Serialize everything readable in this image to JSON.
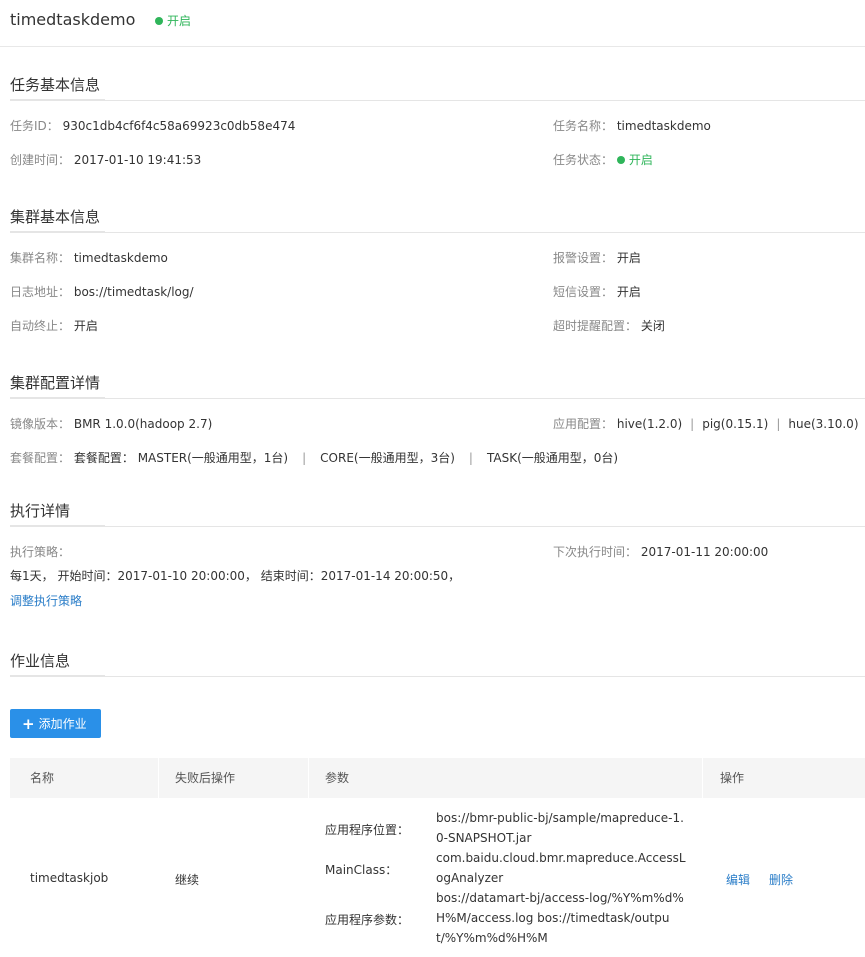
{
  "header": {
    "title": "timedtaskdemo",
    "status": "开启",
    "status_color": "#2fb55a"
  },
  "task_info": {
    "section_title": "任务基本信息",
    "task_id_label": "任务ID：",
    "task_id": "930c1db4cf6f4c58a69923c0db58e474",
    "task_name_label": "任务名称：",
    "task_name": "timedtaskdemo",
    "create_time_label": "创建时间：",
    "create_time": "2017-01-10 19:41:53",
    "task_status_label": "任务状态：",
    "task_status": "开启"
  },
  "cluster_info": {
    "section_title": "集群基本信息",
    "cluster_name_label": "集群名称：",
    "cluster_name": "timedtaskdemo",
    "alarm_label": "报警设置：",
    "alarm": "开启",
    "log_label": "日志地址：",
    "log": "bos://timedtask/log/",
    "sms_label": "短信设置：",
    "sms": "开启",
    "auto_stop_label": "自动终止：",
    "auto_stop": "开启",
    "timeout_label": "超时提醒配置：",
    "timeout": "关闭"
  },
  "cluster_config": {
    "section_title": "集群配置详情",
    "image_label": "镜像版本：",
    "image": "BMR 1.0.0(hadoop 2.7)",
    "apps_label": "应用配置：",
    "apps": [
      "hive(1.2.0)",
      "pig(0.15.1)",
      "hue(3.10.0)"
    ],
    "package_label": "套餐配置：",
    "package_prefix": "套餐配置：",
    "packages": [
      "MASTER(一般通用型，1台)",
      "CORE(一般通用型，3台)",
      "TASK(一般通用型，0台)"
    ],
    "separator": "|"
  },
  "execution": {
    "section_title": "执行详情",
    "policy_label": "执行策略：",
    "next_label": "下次执行时间：",
    "next_time": "2017-01-11 20:00:00",
    "policy_text": "每1天， 开始时间：2017-01-10 20:00:00， 结束时间：2017-01-14 20:00:50，",
    "adjust_link": "调整执行策略"
  },
  "jobs": {
    "section_title": "作业信息",
    "add_button": "添加作业",
    "columns": [
      "名称",
      "失败后操作",
      "参数",
      "操作"
    ],
    "rows": [
      {
        "name": "timedtaskjob",
        "fail_action": "继续",
        "param_labels": [
          "应用程序位置：",
          "MainClass：",
          "应用程序参数："
        ],
        "jar": "bos://bmr-public-bj/sample/mapreduce-1.0-SNAPSHOT.jar",
        "main_class": "com.baidu.cloud.bmr.mapreduce.AccessLogAnalyzer",
        "args": "bos://datamart-bj/access-log/%Y%m%d%H%M/access.log bos://timedtask/output/%Y%m%d%H%M",
        "edit": "编辑",
        "delete": "删除"
      }
    ]
  }
}
